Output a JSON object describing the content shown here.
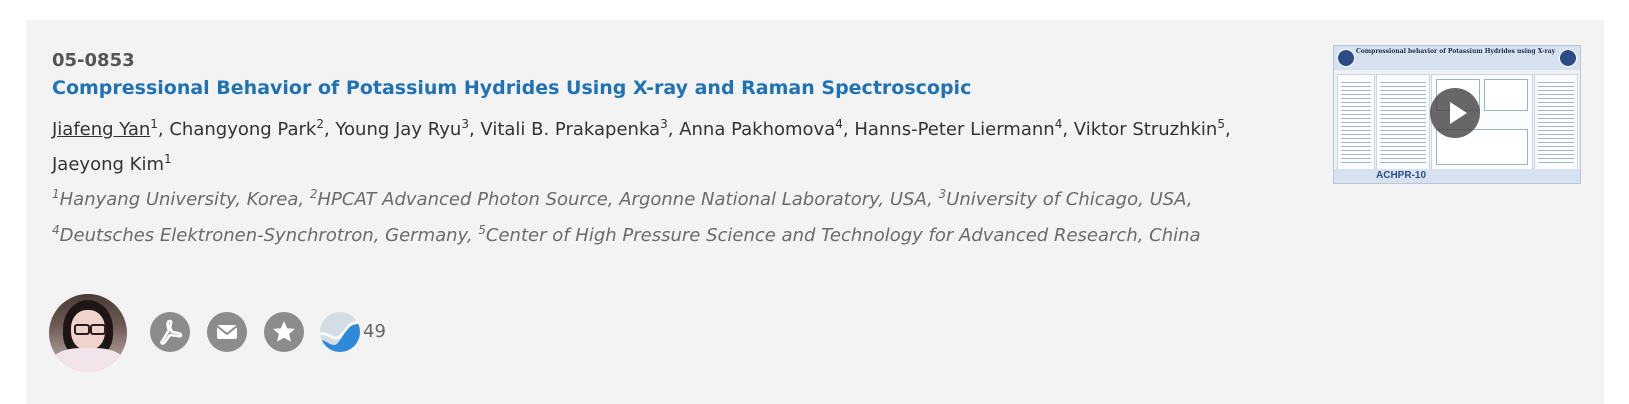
{
  "abstract": {
    "code": "05-0853",
    "title": "Compressional Behavior of Potassium Hydrides Using X-ray and Raman Spectroscopic",
    "authors": [
      {
        "name": "Jiafeng Yan",
        "sup": "1",
        "presenter": true,
        "sep": ", "
      },
      {
        "name": "Changyong Park",
        "sup": "2",
        "sep": ", "
      },
      {
        "name": "Young Jay Ryu",
        "sup": "3",
        "sep": ", "
      },
      {
        "name": "Vitali B. Prakapenka",
        "sup": "3",
        "sep": ", "
      },
      {
        "name": "Anna Pakhomova",
        "sup": "4",
        "sep": ", "
      },
      {
        "name": "Hanns-Peter Liermann",
        "sup": "4",
        "sep": ", "
      },
      {
        "name": "Viktor Struzhkin",
        "sup": "5",
        "sep": ", "
      },
      {
        "name": "Jaeyong Kim",
        "sup": "1",
        "sep": ""
      }
    ],
    "affiliations": [
      {
        "sup": "1",
        "text": "Hanyang University, Korea",
        "sep": ", "
      },
      {
        "sup": "2",
        "text": "HPCAT Advanced Photon Source, Argonne National Laboratory, USA",
        "sep": ", "
      },
      {
        "sup": "3",
        "text": "University of Chicago, USA",
        "sep": ", "
      },
      {
        "sup": "4",
        "text": "Deutsches Elektronen-Synchrotron, Germany",
        "sep": ", "
      },
      {
        "sup": "5",
        "text": "Center of High Pressure Science and Technology for Advanced Research, China",
        "sep": ""
      }
    ]
  },
  "poster_thumbnail": {
    "title": "Compressional behavior of Potassium Hydrides using X-ray Diffraction and Raman spectroscopy",
    "footer": "ACHPR-10"
  },
  "actions": {
    "icons": [
      "pdf-icon",
      "email-icon",
      "favorite-star-icon",
      "metrics-wave-icon"
    ],
    "metric_count": "49"
  },
  "colors": {
    "title": "#1f72b4",
    "icon_gray": "#8c8c8c",
    "metric_blue": "#2e8ad8",
    "card_bg": "#f3f3f3"
  }
}
